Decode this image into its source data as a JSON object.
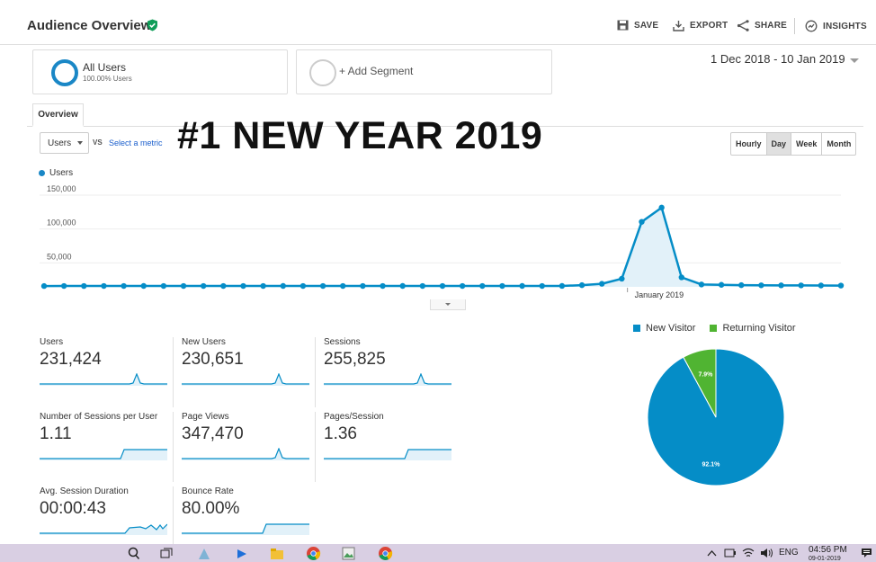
{
  "header": {
    "title": "Audience Overview",
    "save_label": "SAVE",
    "export_label": "EXPORT",
    "share_label": "SHARE",
    "insights_label": "INSIGHTS"
  },
  "segments": {
    "all_users_label": "All Users",
    "all_users_sub": "100.00% Users",
    "add_segment_label": "+ Add Segment"
  },
  "date_range": "1 Dec 2018 - 10 Jan 2019",
  "tabs": {
    "overview": "Overview"
  },
  "controls": {
    "metric": "Users",
    "vs": "VS",
    "select_metric": "Select a metric",
    "granularity": [
      "Hourly",
      "Day",
      "Week",
      "Month"
    ],
    "active_granularity": "Day"
  },
  "headline": "#1 NEW YEAR 2019",
  "chart_data": [
    {
      "type": "area",
      "series": [
        {
          "name": "Users",
          "values": [
            1200,
            1300,
            1250,
            1300,
            1280,
            1320,
            1300,
            1290,
            1310,
            1300,
            1280,
            1300,
            1320,
            1310,
            1300,
            1290,
            1310,
            1300,
            1320,
            1300,
            1310,
            1300,
            1290,
            1300,
            1320,
            1300,
            1350,
            2500,
            4500,
            12000,
            96000,
            117000,
            14000,
            3500,
            3000,
            2500,
            2300,
            2200,
            2100,
            2000,
            1900
          ]
        }
      ],
      "ylim": [
        0,
        150000
      ],
      "yticks": [
        "150,000",
        "100,000",
        "50,000"
      ],
      "x_label": "January 2019",
      "x_label_index": 31,
      "color": "#058dc7",
      "fill": "#e2f1f9",
      "grid": true
    },
    {
      "type": "pie",
      "series": [
        {
          "name": "New Visitor",
          "values": [
            92.1
          ],
          "color": "#058dc7",
          "label": "92.1%"
        },
        {
          "name": "Returning Visitor",
          "values": [
            7.9
          ],
          "color": "#50b432",
          "label": "7.9%"
        }
      ]
    }
  ],
  "tiles": [
    {
      "label": "Users",
      "value": "231,424",
      "spark": "spike"
    },
    {
      "label": "New Users",
      "value": "230,651",
      "spark": "spike"
    },
    {
      "label": "Sessions",
      "value": "255,825",
      "spark": "spike"
    },
    {
      "label": "Number of Sessions per User",
      "value": "1.11",
      "spark": "step"
    },
    {
      "label": "Page Views",
      "value": "347,470",
      "spark": "spike"
    },
    {
      "label": "Pages/Session",
      "value": "1.36",
      "spark": "step"
    },
    {
      "label": "Avg. Session Duration",
      "value": "00:00:43",
      "spark": "wiggle"
    },
    {
      "label": "Bounce Rate",
      "value": "80.00%",
      "spark": "step"
    }
  ],
  "taskbar": {
    "language": "ENG",
    "time": "04:56 PM",
    "date": "09-01-2019"
  }
}
